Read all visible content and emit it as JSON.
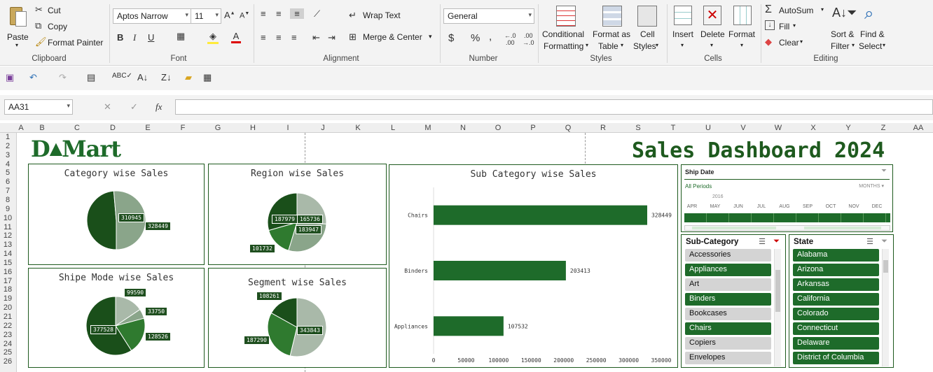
{
  "ribbon": {
    "clipboard": {
      "paste": "Paste",
      "cut": "Cut",
      "copy": "Copy",
      "format_painter": "Format Painter",
      "group": "Clipboard"
    },
    "font": {
      "name": "Aptos Narrow",
      "size": "11",
      "group": "Font",
      "bold": "B",
      "italic": "I",
      "underline": "U"
    },
    "alignment": {
      "wrap": "Wrap Text",
      "merge": "Merge & Center",
      "group": "Alignment"
    },
    "number": {
      "format": "General",
      "currency": "$",
      "percent": "%",
      "comma": ",",
      "group": "Number"
    },
    "styles": {
      "conditional": "Conditional",
      "conditional2": "Formatting",
      "format_table": "Format as",
      "format_table2": "Table",
      "cell_styles": "Cell",
      "cell_styles2": "Styles",
      "group": "Styles"
    },
    "cells": {
      "insert": "Insert",
      "delete": "Delete",
      "format": "Format",
      "group": "Cells"
    },
    "editing": {
      "autosum": "AutoSum",
      "fill": "Fill",
      "clear": "Clear",
      "sort": "Sort &",
      "sort2": "Filter",
      "find": "Find &",
      "find2": "Select",
      "group": "Editing"
    }
  },
  "formula_bar": {
    "name_box": "AA31",
    "fx": "fx",
    "value": ""
  },
  "columns": [
    "A",
    "B",
    "C",
    "D",
    "E",
    "F",
    "G",
    "H",
    "I",
    "J",
    "K",
    "L",
    "M",
    "N",
    "O",
    "P",
    "Q",
    "R",
    "S",
    "T",
    "U",
    "V",
    "W",
    "X",
    "Y",
    "Z",
    "AA"
  ],
  "rows": [
    "1",
    "2",
    "3",
    "4",
    "5",
    "6",
    "7",
    "8",
    "9",
    "10",
    "11",
    "12",
    "13",
    "14",
    "15",
    "16",
    "17",
    "18",
    "19",
    "20",
    "21",
    "22",
    "23",
    "24",
    "25",
    "26"
  ],
  "dashboard": {
    "logo_left": "D",
    "logo_right": "Mart",
    "title": "Sales Dashboard 2024",
    "colors": {
      "dark": "#1a4f1a",
      "mid": "#2f7a2f",
      "light": "#8aa58a",
      "pale": "#a9b9a9",
      "bar": "#1e6b2a"
    }
  },
  "charts": {
    "category": {
      "title": "Category wise Sales",
      "labels": [
        "310945",
        "328449"
      ]
    },
    "region": {
      "title": "Region wise Sales",
      "labels": [
        "187979",
        "165736",
        "183947",
        "101732"
      ]
    },
    "shipmode": {
      "title": "Shipe Mode wise Sales",
      "labels": [
        "99590",
        "33750",
        "377528",
        "128526"
      ]
    },
    "segment": {
      "title": "Segment wise Sales",
      "labels": [
        "108261",
        "187290",
        "343843"
      ]
    },
    "subcategory": {
      "title": "Sub Category wise Sales"
    }
  },
  "chart_data": [
    {
      "type": "pie",
      "title": "Category wise Sales",
      "values": [
        310945,
        328449
      ]
    },
    {
      "type": "pie",
      "title": "Region wise Sales",
      "values": [
        165736,
        183947,
        101732,
        187979
      ]
    },
    {
      "type": "pie",
      "title": "Shipe Mode wise Sales",
      "values": [
        99590,
        33750,
        128526,
        377528
      ]
    },
    {
      "type": "pie",
      "title": "Segment wise Sales",
      "values": [
        343843,
        187290,
        108261
      ]
    },
    {
      "type": "bar",
      "title": "Sub Category wise Sales",
      "orientation": "horizontal",
      "categories": [
        "Chairs",
        "Binders",
        "Appliances"
      ],
      "values": [
        328449,
        203413,
        107532
      ],
      "xlim": [
        0,
        350000
      ],
      "xticks": [
        "0",
        "50000",
        "100000",
        "150000",
        "200000",
        "250000",
        "300000",
        "350000"
      ]
    }
  ],
  "timeline": {
    "title": "Ship Date",
    "period": "All Periods",
    "unit": "MONTHS",
    "year": "2016",
    "months": [
      "APR",
      "MAY",
      "JUN",
      "JUL",
      "AUG",
      "SEP",
      "OCT",
      "NOV",
      "DEC"
    ]
  },
  "subcategory_slicer": {
    "title": "Sub-Category",
    "items": [
      {
        "label": "Accessories",
        "on": false
      },
      {
        "label": "Appliances",
        "on": true
      },
      {
        "label": "Art",
        "on": false
      },
      {
        "label": "Binders",
        "on": true
      },
      {
        "label": "Bookcases",
        "on": false
      },
      {
        "label": "Chairs",
        "on": true
      },
      {
        "label": "Copiers",
        "on": false
      },
      {
        "label": "Envelopes",
        "on": false
      }
    ]
  },
  "state_slicer": {
    "title": "State",
    "items": [
      {
        "label": "Alabama",
        "on": true
      },
      {
        "label": "Arizona",
        "on": true
      },
      {
        "label": "Arkansas",
        "on": true
      },
      {
        "label": "California",
        "on": true
      },
      {
        "label": "Colorado",
        "on": true
      },
      {
        "label": "Connecticut",
        "on": true
      },
      {
        "label": "Delaware",
        "on": true
      },
      {
        "label": "District of Columbia",
        "on": true
      }
    ]
  }
}
